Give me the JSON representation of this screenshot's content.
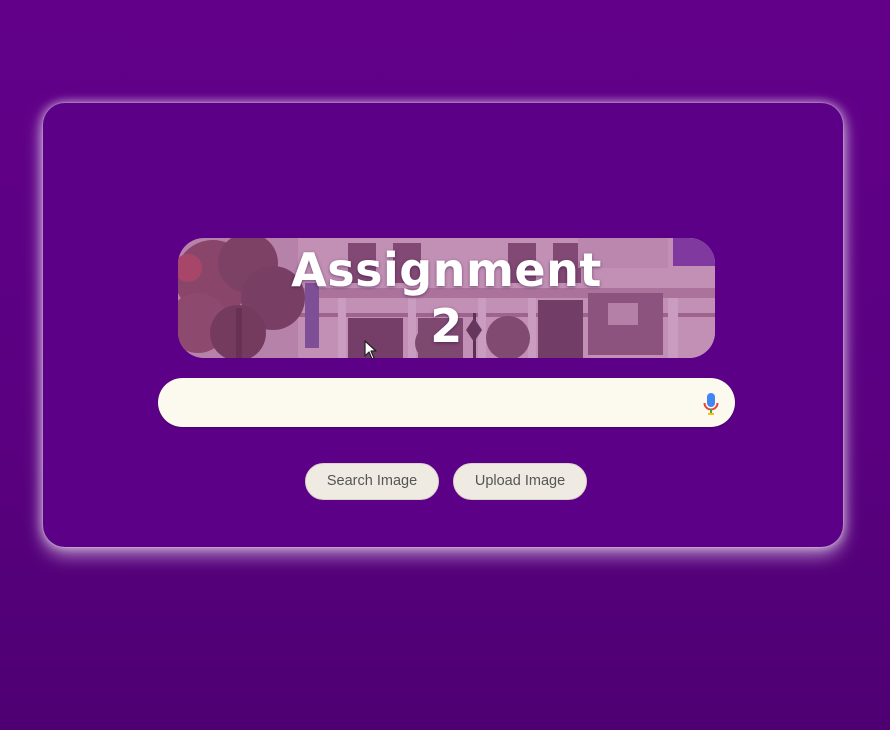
{
  "banner": {
    "title_line1": "Assignment",
    "title_line2": "2"
  },
  "search": {
    "value": "",
    "placeholder": "",
    "mic_icon": "microphone-icon"
  },
  "buttons": {
    "search_image": "Search Image",
    "upload_image": "Upload Image"
  },
  "colors": {
    "background": "#5e0087",
    "card": "#5d0088",
    "search_bar": "#fcf9ef",
    "button": "#efebe3",
    "button_text": "#555555"
  }
}
